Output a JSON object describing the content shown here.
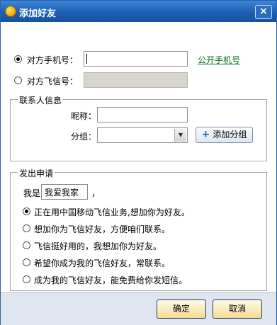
{
  "title": "添加好友",
  "target": {
    "mobile_label": "对方手机号：",
    "fetion_label": "对方飞信号：",
    "public_mobile_link": "公开手机号",
    "selected": "mobile"
  },
  "contact_info": {
    "legend": "联系人信息",
    "nickname_label": "昵称：",
    "group_label": "分组：",
    "add_group_button": "添加分组"
  },
  "request": {
    "legend": "发出申请",
    "me_label": "我是",
    "me_value": "我爱我家",
    "me_suffix": "，",
    "options": [
      "正在用中国移动飞信业务,想加你为好友。",
      "想加你为飞信好友，方便咱们联系。",
      "飞信挺好用的，我想加你为好友。",
      "希望你成为我的飞信好友，常联系。",
      "成为我的飞信好友，能免费给你发短信。"
    ],
    "selected_index": 0
  },
  "footer": {
    "ok_label": "确定",
    "cancel_label": "取消"
  }
}
